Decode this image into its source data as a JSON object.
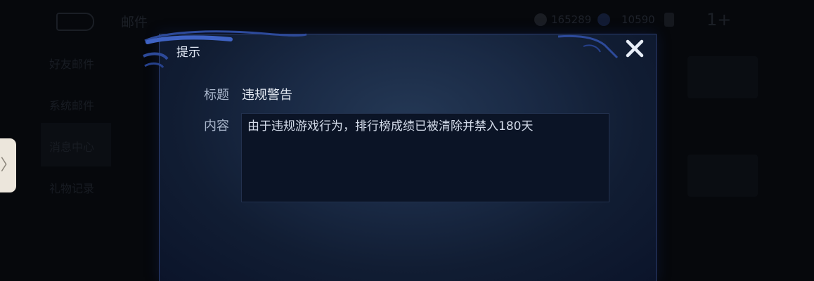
{
  "background": {
    "title": "邮件",
    "currency": [
      {
        "icon": "coin-icon",
        "value": "165289"
      },
      {
        "icon": "gem-icon",
        "value": "10590"
      }
    ],
    "plus": "1+",
    "sidebar": [
      "好友邮件",
      "系统邮件",
      "消息中心",
      "礼物记录"
    ],
    "edge_handle": "〉"
  },
  "dialog": {
    "title": "提示",
    "title_label": "标题",
    "title_value": "违规警告",
    "content_label": "内容",
    "content_value": "由于违规游戏行为，排行榜成绩已被清除并禁入180天"
  },
  "colors": {
    "accent_border": "#2b3e72",
    "dialog_bg": "#1a2a45",
    "text_primary": "#e6ecf5",
    "text_label": "#aab7cc"
  }
}
